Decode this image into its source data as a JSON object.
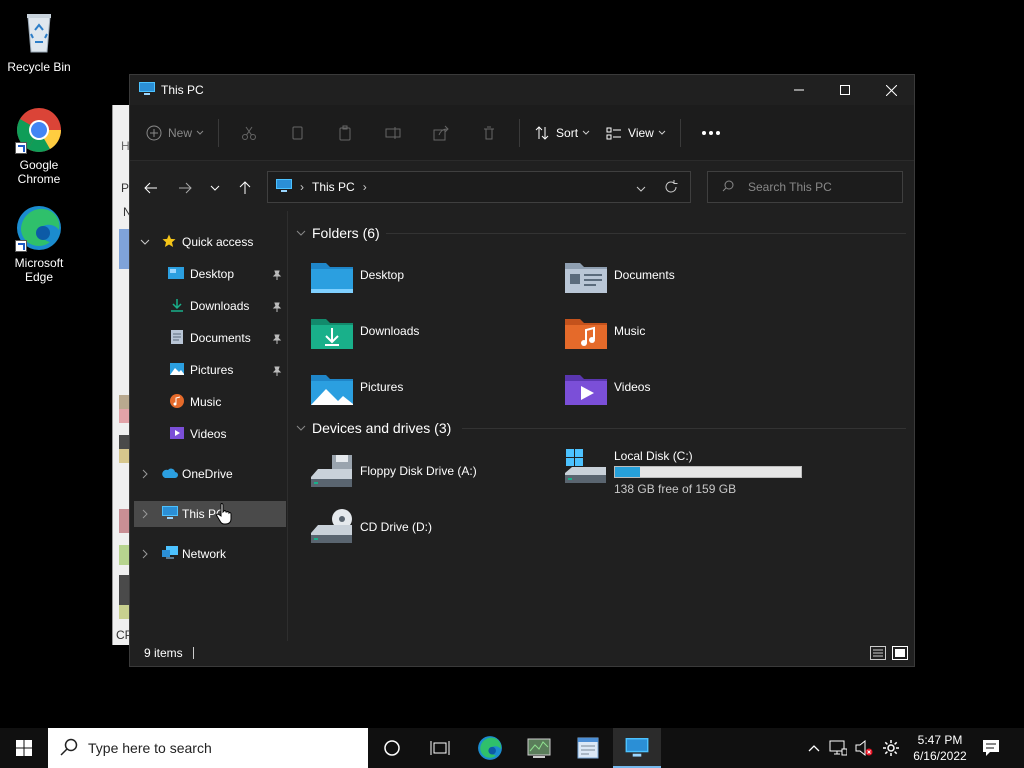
{
  "desktop": {
    "icons": [
      {
        "label": "Recycle Bin",
        "icon": "recycle-bin-icon"
      },
      {
        "label": "Google Chrome",
        "icon": "chrome-icon"
      },
      {
        "label": "Microsoft Edge",
        "icon": "edge-icon"
      }
    ],
    "background_window": {
      "letters": [
        "H",
        "Pr",
        "N",
        "CP"
      ]
    }
  },
  "explorer": {
    "title": "This PC",
    "toolbar": {
      "new_label": "New",
      "sort_label": "Sort",
      "view_label": "View"
    },
    "address": {
      "crumb": "This PC"
    },
    "search": {
      "placeholder": "Search This PC"
    },
    "sidebar": {
      "quick_access": "Quick access",
      "items": [
        {
          "label": "Desktop",
          "pinned": true
        },
        {
          "label": "Downloads",
          "pinned": true
        },
        {
          "label": "Documents",
          "pinned": true
        },
        {
          "label": "Pictures",
          "pinned": true
        },
        {
          "label": "Music",
          "pinned": false
        },
        {
          "label": "Videos",
          "pinned": false
        }
      ],
      "onedrive": "OneDrive",
      "this_pc": "This PC",
      "network": "Network"
    },
    "folders": {
      "heading": "Folders (6)",
      "items": [
        "Desktop",
        "Documents",
        "Downloads",
        "Music",
        "Pictures",
        "Videos"
      ]
    },
    "drives": {
      "heading": "Devices and drives (3)",
      "floppy": "Floppy Disk Drive (A:)",
      "local": {
        "name": "Local Disk (C:)",
        "free": "138 GB free of 159 GB",
        "used_fraction": 0.132
      },
      "cd": "CD Drive (D:)"
    },
    "status": {
      "items": "9 items"
    }
  },
  "taskbar": {
    "search_placeholder": "Type here to search",
    "time": "5:47 PM",
    "date": "6/16/2022"
  },
  "colors": {
    "accent": "#4cc2ff",
    "folder_blue": "#2b9fe0",
    "folder_gray": "#b9c6d6",
    "folder_green": "#19b08a",
    "folder_orange": "#e56a2a",
    "folder_purple": "#7b4fd8",
    "drive_bar": "#26a0da"
  }
}
